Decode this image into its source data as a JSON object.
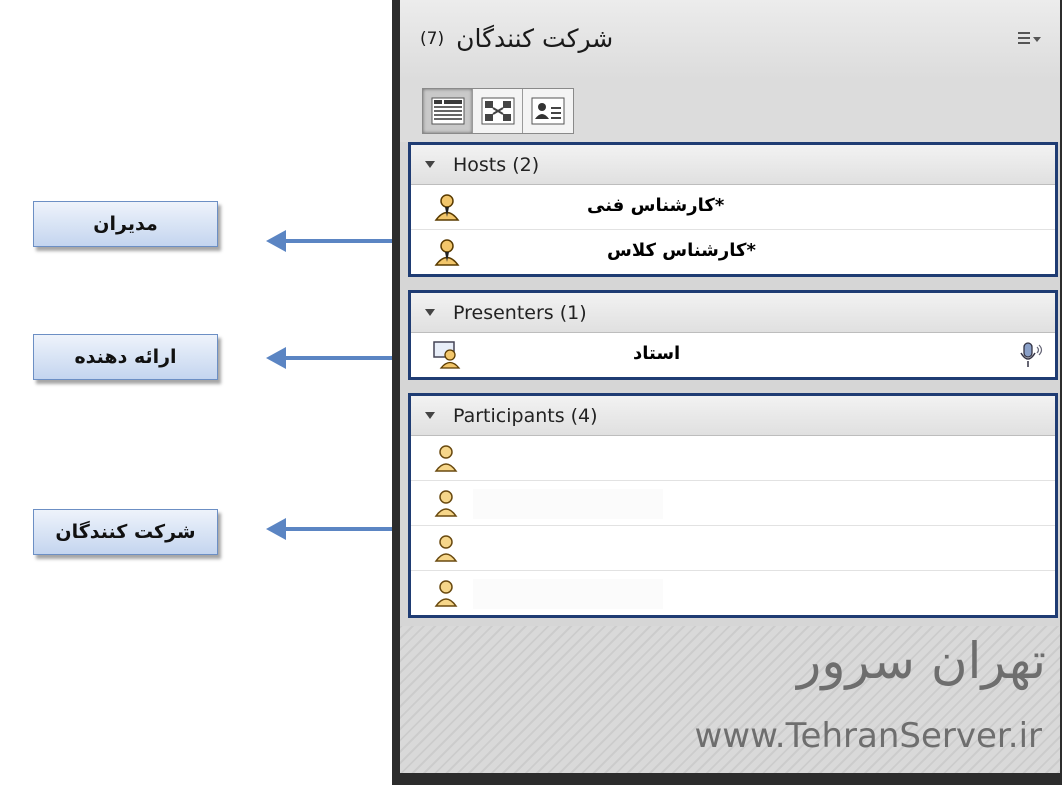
{
  "callouts": [
    {
      "label": "مدیران"
    },
    {
      "label": "ارائه دهنده"
    },
    {
      "label": "شرکت کنندگان"
    }
  ],
  "panel": {
    "title": "شرکت کنندگان",
    "count": "(7)",
    "menu_icon": "menu-lines-icon",
    "view_buttons": [
      "list-view-icon",
      "expand-view-icon",
      "attendee-details-icon"
    ]
  },
  "groups": {
    "hosts": {
      "header": "Hosts (2)",
      "rows": [
        {
          "name": "*کارشناس فنی"
        },
        {
          "name": "*کارشناس کلاس"
        }
      ]
    },
    "presenters": {
      "header": "Presenters (1)",
      "rows": [
        {
          "name": "استاد"
        }
      ]
    },
    "participants": {
      "header": "Participants (4)",
      "rows": [
        {
          "name": ""
        },
        {
          "name": ""
        },
        {
          "name": ""
        },
        {
          "name": ""
        }
      ]
    }
  },
  "watermark": {
    "fa": "تهران سرور",
    "en": "www.TehranServer.ir"
  },
  "colors": {
    "group_border": "#1f3c73",
    "arrow": "#5b85c3",
    "callout_border": "#6c8fc4"
  }
}
